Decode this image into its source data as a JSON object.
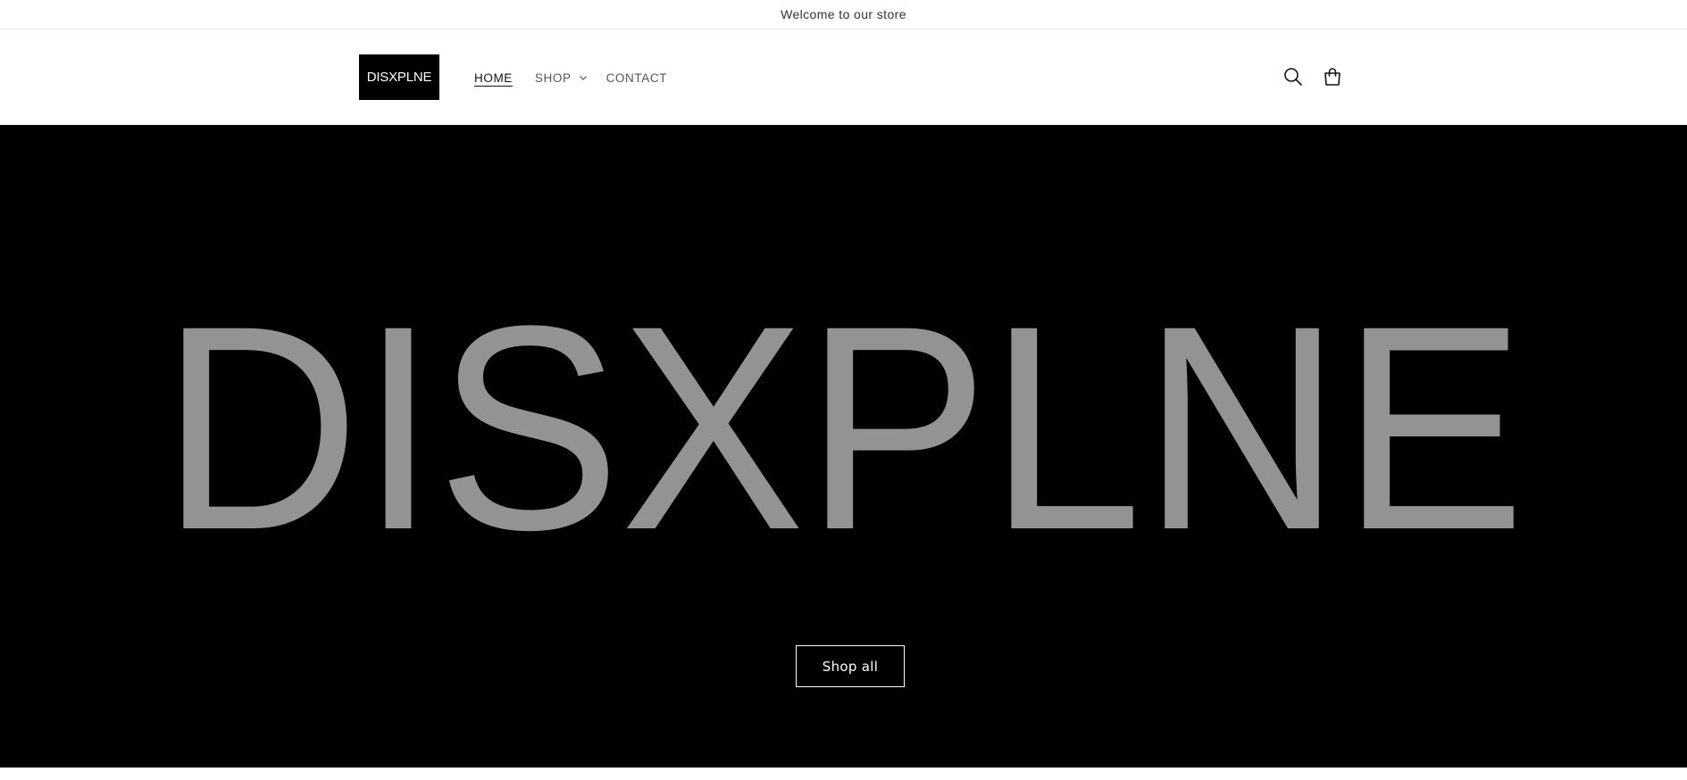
{
  "announcement": {
    "text": "Welcome to our store"
  },
  "header": {
    "logo_text": "DISXPLNE",
    "nav": [
      {
        "label": "HOME",
        "active": true
      },
      {
        "label": "SHOP",
        "has_dropdown": true
      },
      {
        "label": "CONTACT"
      }
    ],
    "icons": [
      "search-icon",
      "cart-icon"
    ]
  },
  "hero": {
    "image_text": "DISXPLNE",
    "button_label": "Shop all"
  },
  "colors": {
    "hero_background": "#000000",
    "hero_text": "#939393",
    "header_background": "#ffffff",
    "logo_background": "#000000"
  }
}
